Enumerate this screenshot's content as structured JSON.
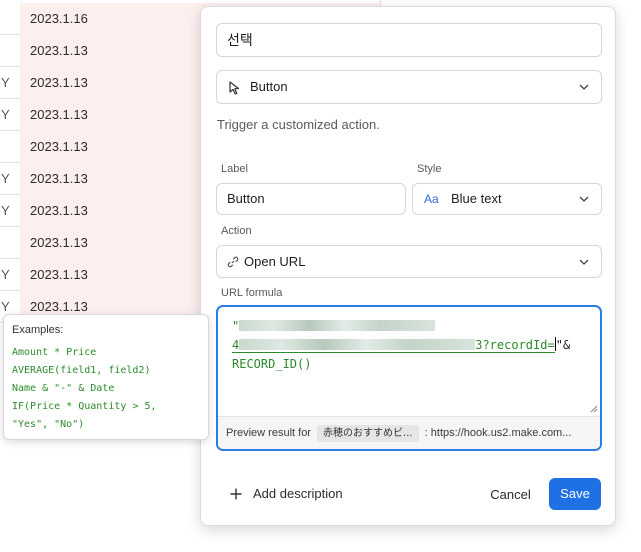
{
  "grid": {
    "rows": [
      {
        "edge": "",
        "date": "2023.1.16"
      },
      {
        "edge": "",
        "date": "2023.1.13"
      },
      {
        "edge": "Y",
        "date": "2023.1.13"
      },
      {
        "edge": "Y",
        "date": "2023.1.13"
      },
      {
        "edge": "",
        "date": "2023.1.13"
      },
      {
        "edge": "Y",
        "date": "2023.1.13"
      },
      {
        "edge": "Y",
        "date": "2023.1.13"
      },
      {
        "edge": "",
        "date": "2023.1.13"
      },
      {
        "edge": "Y",
        "date": "2023.1.13"
      },
      {
        "edge": "Y",
        "date": "2023.1.13"
      }
    ]
  },
  "examples": {
    "title": "Examples:",
    "lines": [
      "Amount * Price",
      "AVERAGE(field1, field2)",
      "Name & \"-\" & Date",
      "IF(Price * Quantity > 5,",
      "\"Yes\", \"No\")"
    ]
  },
  "panel": {
    "field_name": "선택",
    "field_type": "Button",
    "type_description": "Trigger a customized action.",
    "label_caption": "Label",
    "label_value": "Button",
    "style_caption": "Style",
    "style_icon_text": "Aa",
    "style_value": "Blue text",
    "action_caption": "Action",
    "action_value": "Open URL",
    "url_caption": "URL formula",
    "formula": {
      "line1_prefix": "\"",
      "line2_prefix": "4",
      "line2_visible": "3?recordId=",
      "line2_suffix": "\"&",
      "line3": "RECORD_ID()"
    },
    "preview_label": "Preview result for",
    "preview_chip": "赤穂のおすすめビ...",
    "preview_value": ": https://hook.us2.make.com...",
    "add_description": "Add description",
    "cancel": "Cancel",
    "save": "Save"
  },
  "colors": {
    "accent": "#1f6fe5",
    "focus_border": "#2d7be5",
    "formula_green": "#2c8a2c",
    "date_cell_bg": "#fdefee"
  },
  "icons": {
    "type": "cursor-arrow-icon",
    "action": "link-icon",
    "dropdown": "chevron-down-icon",
    "add": "plus-icon",
    "resize": "resize-handle-icon"
  }
}
